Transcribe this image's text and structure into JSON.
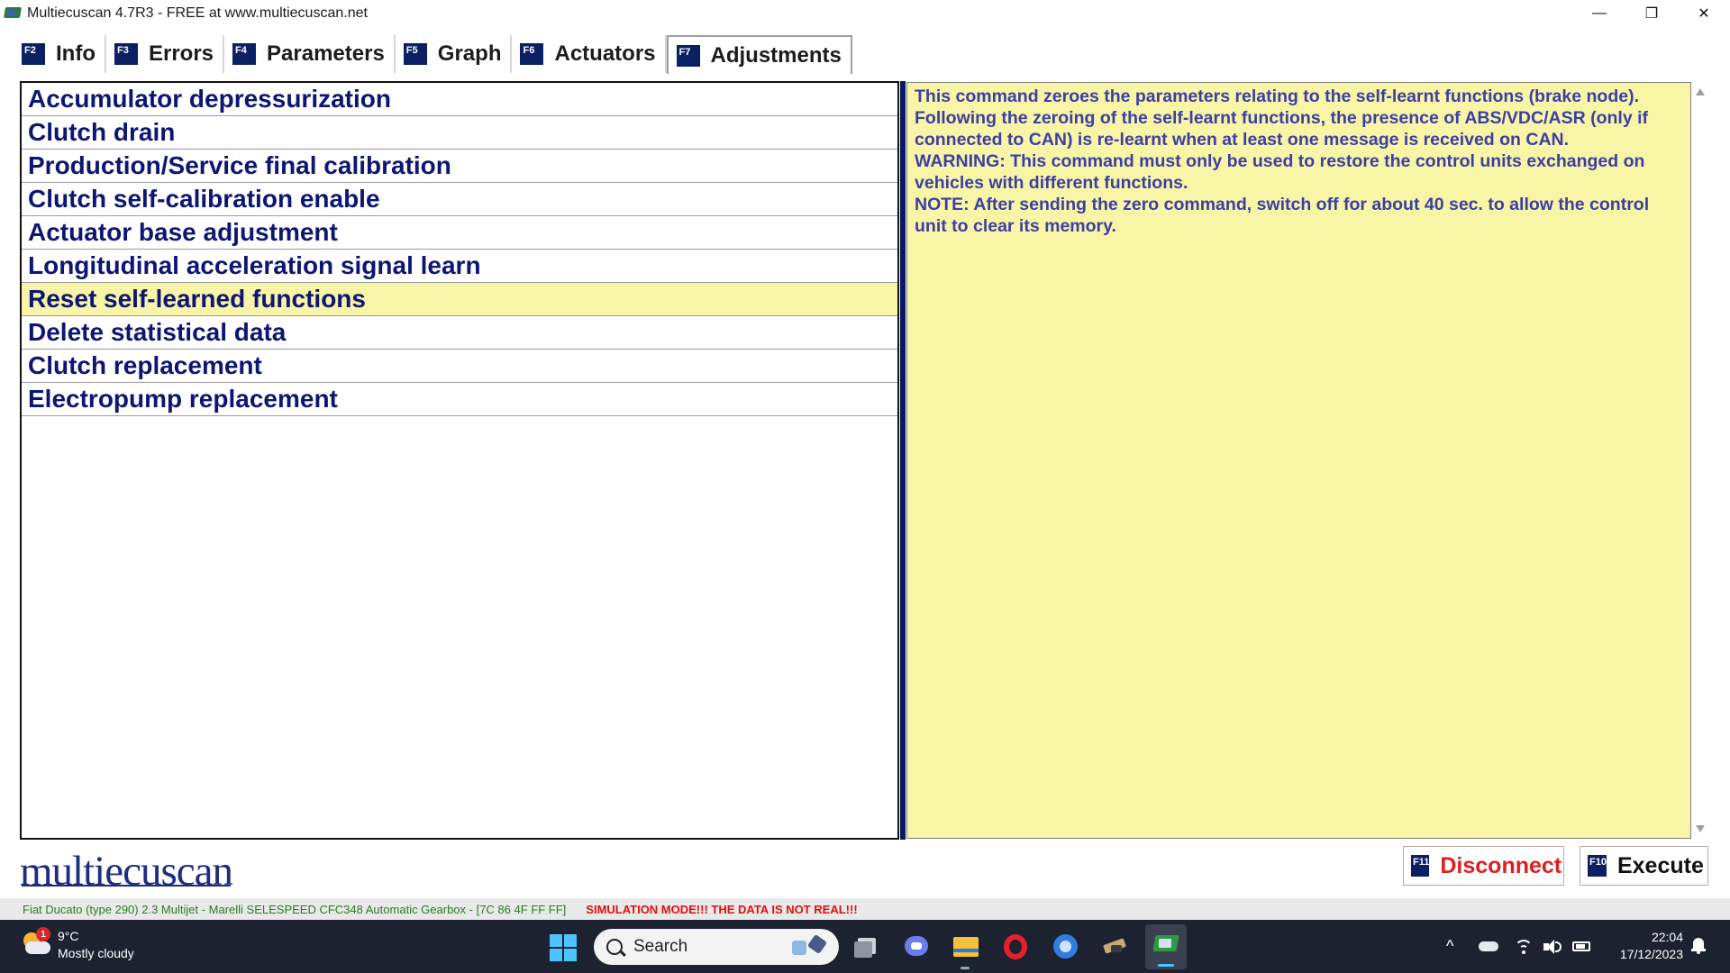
{
  "window": {
    "title": "Multiecuscan 4.7R3 - FREE at www.multiecuscan.net",
    "minimize_glyph": "—",
    "restore_glyph": "❐",
    "close_glyph": "✕"
  },
  "tabs": [
    {
      "key": "F2",
      "label": "Info"
    },
    {
      "key": "F3",
      "label": "Errors"
    },
    {
      "key": "F4",
      "label": "Parameters"
    },
    {
      "key": "F5",
      "label": "Graph"
    },
    {
      "key": "F6",
      "label": "Actuators"
    },
    {
      "key": "F7",
      "label": "Adjustments"
    }
  ],
  "active_tab": "Adjustments",
  "adjustments": [
    "Accumulator depressurization",
    "Clutch drain",
    "Production/Service final calibration",
    "Clutch self-calibration enable",
    "Actuator base adjustment",
    "Longitudinal acceleration signal learn",
    "Reset self-learned functions",
    "Delete statistical data",
    "Clutch replacement",
    "Electropump replacement"
  ],
  "selected_adjustment": "Reset self-learned functions",
  "description": [
    "This command zeroes the parameters relating to the self-learnt functions (brake node).",
    "Following the zeroing of the self-learnt functions, the presence of ABS/VDC/ASR (only if",
    "connected to CAN) is re-learnt when at least one message is received on CAN.",
    "WARNING: This command must only be used to restore the control units exchanged on",
    "vehicles with different functions.",
    "NOTE: After sending the zero command, switch off for about 40 sec. to allow the control",
    "unit to clear its memory."
  ],
  "logo": "multiecuscan",
  "buttons": {
    "disconnect": {
      "key": "F11",
      "label": "Disconnect"
    },
    "execute": {
      "key": "F10",
      "label": "Execute"
    }
  },
  "status": {
    "vehicle": "Fiat Ducato (type 290) 2.3 Multijet - Marelli SELESPEED CFC348 Automatic Gearbox - [7C 86 4F FF FF]",
    "warning": "SIMULATION MODE!!! THE DATA IS NOT REAL!!!"
  },
  "taskbar": {
    "weather_badge": "1",
    "temperature": "9°C",
    "condition": "Mostly cloudy",
    "search_label": "Search",
    "time": "22:04",
    "date": "17/12/2023",
    "tray_chevron": "^"
  },
  "colors": {
    "accent_navy": "#0b1f63",
    "list_text": "#0d1673",
    "selected_row": "#f8f4a8",
    "description_bg": "#f8f5a6",
    "description_text": "#3b3fa5",
    "disconnect_red": "#e01e1e",
    "status_green": "#2a7a1f",
    "taskbar_bg": "#1d2230"
  }
}
